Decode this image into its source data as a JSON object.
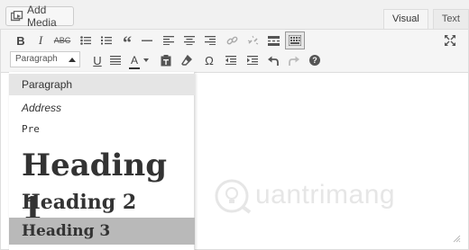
{
  "top": {
    "add_media_label": "Add Media",
    "tabs": [
      "Visual",
      "Text"
    ]
  },
  "toolbar": {
    "row1_icons": [
      "bold-icon",
      "italic-icon",
      "strikethrough-icon",
      "bullet-list-icon",
      "numbered-list-icon",
      "blockquote-icon",
      "horizontal-rule-icon",
      "align-left-icon",
      "align-center-icon",
      "align-right-icon",
      "insert-link-icon",
      "remove-link-icon",
      "read-more-icon",
      "toolbar-toggle-icon",
      "fullscreen-icon"
    ],
    "format_value": "Paragraph",
    "row2_icons": [
      "underline-icon",
      "justify-icon",
      "text-color-icon",
      "paste-as-text-icon",
      "clear-formatting-icon",
      "special-character-icon",
      "decrease-indent-icon",
      "increase-indent-icon",
      "undo-icon",
      "redo-icon",
      "help-icon"
    ],
    "text_color_letter": "A",
    "text_color": "#333333"
  },
  "format_menu": {
    "items": [
      "Paragraph",
      "Address",
      "Pre",
      "Heading 1",
      "Heading 2",
      "Heading 3"
    ],
    "highlighted_item": "Paragraph",
    "selected_item": "Heading 3"
  },
  "watermark": {
    "text": "uantrimang"
  },
  "colors": {
    "toolbar_bg": "#f5f5f5",
    "menu_selected_bg": "#b9b9b9",
    "menu_hover_bg": "#e5e5e5"
  }
}
